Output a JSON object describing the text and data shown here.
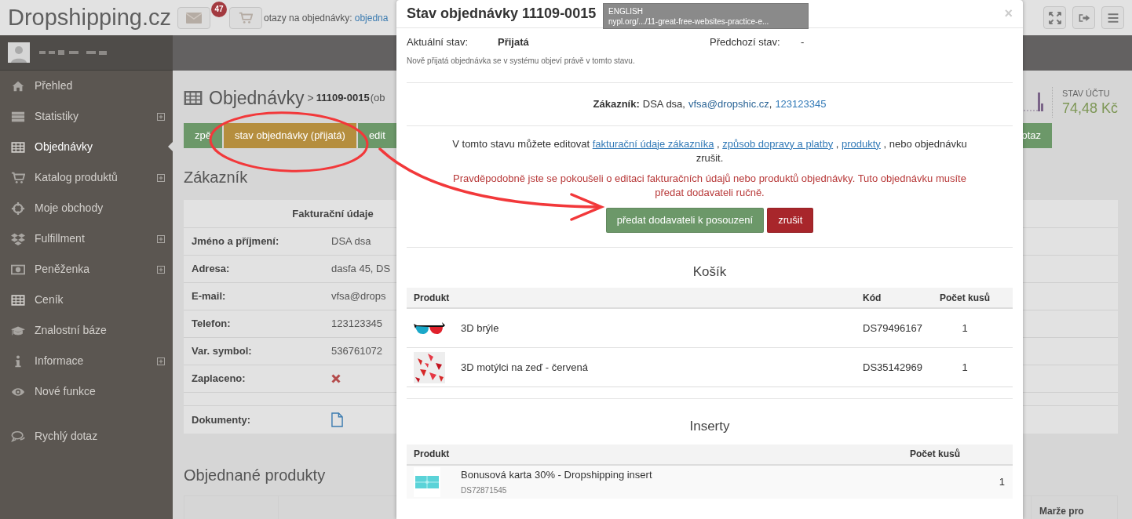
{
  "header": {
    "logo": "Dropshipping.cz",
    "mail_badge": "47",
    "questions_label": "otazy na objednávky:",
    "questions_link": "objedna"
  },
  "sidebar": {
    "items": [
      {
        "label": "Přehled",
        "selected": false,
        "expandable": false
      },
      {
        "label": "Statistiky",
        "selected": false,
        "expandable": true
      },
      {
        "label": "Objednávky",
        "selected": true,
        "expandable": false
      },
      {
        "label": "Katalog produktů",
        "selected": false,
        "expandable": true
      },
      {
        "label": "Moje obchody",
        "selected": false,
        "expandable": false
      },
      {
        "label": "Fulfillment",
        "selected": false,
        "expandable": true
      },
      {
        "label": "Peněženka",
        "selected": false,
        "expandable": true
      },
      {
        "label": "Ceník",
        "selected": false,
        "expandable": false
      },
      {
        "label": "Znalostní báze",
        "selected": false,
        "expandable": false
      },
      {
        "label": "Informace",
        "selected": false,
        "expandable": true
      },
      {
        "label": "Nové funkce",
        "selected": false,
        "expandable": false
      }
    ],
    "quick": {
      "label": "Rychlý dotaz"
    }
  },
  "page": {
    "title": "Objednávky",
    "separator": ">",
    "order": "11109-0015",
    "order_suffix": "(ob",
    "buttons": [
      {
        "label": "zpě",
        "kind": "green"
      },
      {
        "label": "stav objednávky (přijatá)",
        "kind": "orange"
      },
      {
        "label": "edit",
        "kind": "green"
      }
    ],
    "right_button": "otaz",
    "account": {
      "label": "STAV ÚČTU",
      "value": "74,48 Kč"
    },
    "customer_heading": "Zákazník",
    "billing_header": "Fakturační údaje",
    "billing_rows": [
      {
        "label": "Jméno a příjmení:",
        "kind": "text",
        "value": "DSA dsa"
      },
      {
        "label": "Adresa:",
        "kind": "text",
        "value": "dasfa 45, DS"
      },
      {
        "label": "E-mail:",
        "kind": "text",
        "value": "vfsa@drops"
      },
      {
        "label": "Telefon:",
        "kind": "text",
        "value": "123123345"
      },
      {
        "label": "Var. symbol:",
        "kind": "text",
        "value": "536761072"
      },
      {
        "label": "Zaplaceno:",
        "kind": "cross"
      },
      {
        "kind": "empty"
      },
      {
        "label": "Dokumenty:",
        "kind": "document"
      }
    ],
    "products_heading": "Objednané produkty",
    "products_column": "Marže pro"
  },
  "modal": {
    "title": "Stav objednávky 11109-0015",
    "close": "×",
    "current_label": "Aktuální stav:",
    "current_value": "Přijatá",
    "previous_label": "Předchozí stav:",
    "previous_value": "-",
    "note": "Nově přijatá objednávka se v systému objeví právě v tomto stavu.",
    "customer": {
      "label": "Zákazník:",
      "name": "DSA dsa,",
      "email": "vfsa@dropshic.cz",
      "separator": ",",
      "phone": "123123345"
    },
    "edit_text": [
      {
        "kind": "text",
        "text": "V tomto stavu můžete editovat"
      },
      {
        "kind": "link",
        "text": "fakturační údaje zákazníka"
      },
      {
        "kind": "text",
        "text": ","
      },
      {
        "kind": "link",
        "text": "způsob dopravy a platby"
      },
      {
        "kind": "text",
        "text": ","
      },
      {
        "kind": "link",
        "text": "produkty"
      },
      {
        "kind": "text",
        "text": ", nebo objednávku zrušit."
      }
    ],
    "warning": "Pravděpodobně jste se pokoušeli o editaci fakturačních údajů nebo produktů objednávky. Tuto objednávku musíte předat dodavateli ručně.",
    "buttons": [
      {
        "label": "předat dodavateli k posouzení",
        "kind": "green"
      },
      {
        "label": "zrušit",
        "kind": "red"
      }
    ],
    "cart": {
      "heading": "Košík",
      "columns": [
        "Produkt",
        "Kód",
        "Počet kusů"
      ],
      "rows": [
        {
          "name": "3D brýle",
          "code": "DS79496167",
          "qty": "1"
        },
        {
          "name": "3D motýlci na zeď - červená",
          "code": "DS35142969",
          "qty": "1"
        }
      ]
    },
    "inserts": {
      "heading": "Inserty",
      "columns": [
        "Produkt",
        "Počet kusů"
      ],
      "rows": [
        {
          "name": "Bonusová karta 30% - Dropshipping insert",
          "code": "DS72871545",
          "qty": "1"
        }
      ]
    }
  },
  "tooltip": {
    "language": "ENGLISH",
    "url": "nypl.org/.../11-great-free-websites-practice-e..."
  }
}
